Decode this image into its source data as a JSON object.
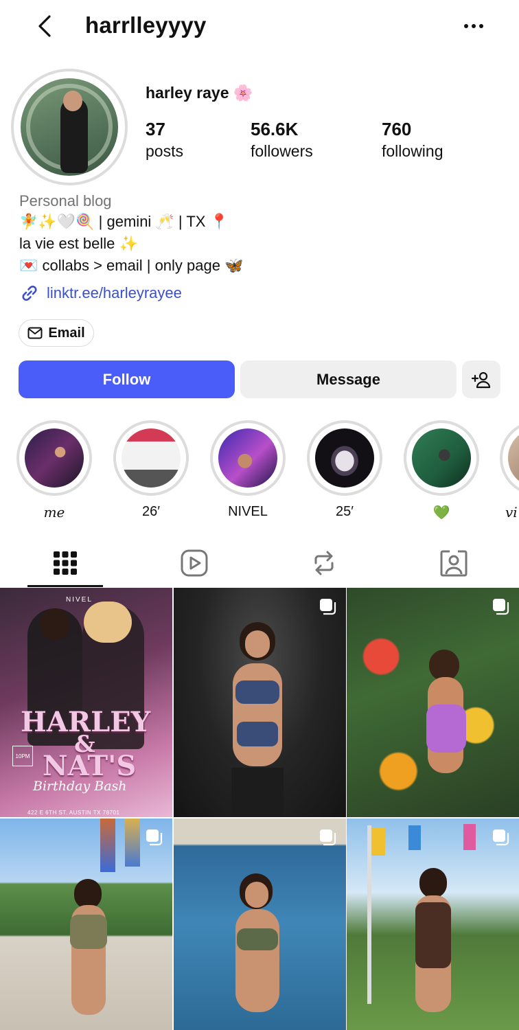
{
  "header": {
    "username": "harrlleyyyy"
  },
  "profile": {
    "display_name": "harley raye 🌸",
    "stats": [
      {
        "value": "37",
        "label": "posts"
      },
      {
        "value": "56.6K",
        "label": "followers"
      },
      {
        "value": "760",
        "label": "following"
      }
    ],
    "category": "Personal blog",
    "bio_lines": [
      "🧚✨🤍🍭 | gemini 🥂 | TX 📍",
      "la vie est belle ✨",
      "💌 collabs > email | only page 🦋"
    ],
    "link": "linktr.ee/harleyrayee"
  },
  "actions": {
    "email_label": "Email",
    "follow_label": "Follow",
    "message_label": "Message"
  },
  "highlights": [
    {
      "label": "me"
    },
    {
      "label": "26′"
    },
    {
      "label": "NIVEL"
    },
    {
      "label": "25′"
    },
    {
      "label": "💚"
    },
    {
      "label": "vi"
    }
  ],
  "tabs": [
    "grid-icon",
    "reels-icon",
    "reposts-icon",
    "tagged-icon"
  ],
  "posts": [
    {
      "title_line1": "HARLEY",
      "title_line2": "&",
      "title_line3": "NAT'S",
      "subtitle": "Birthday Bash",
      "venue": "NIVEL",
      "time_badge": "10PM",
      "address": "422 E 6TH ST. AUSTIN TX 78701"
    }
  ],
  "colors": {
    "follow_button": "#4a5df9",
    "link": "#3a4fd0",
    "secondary_button": "#efefef"
  }
}
